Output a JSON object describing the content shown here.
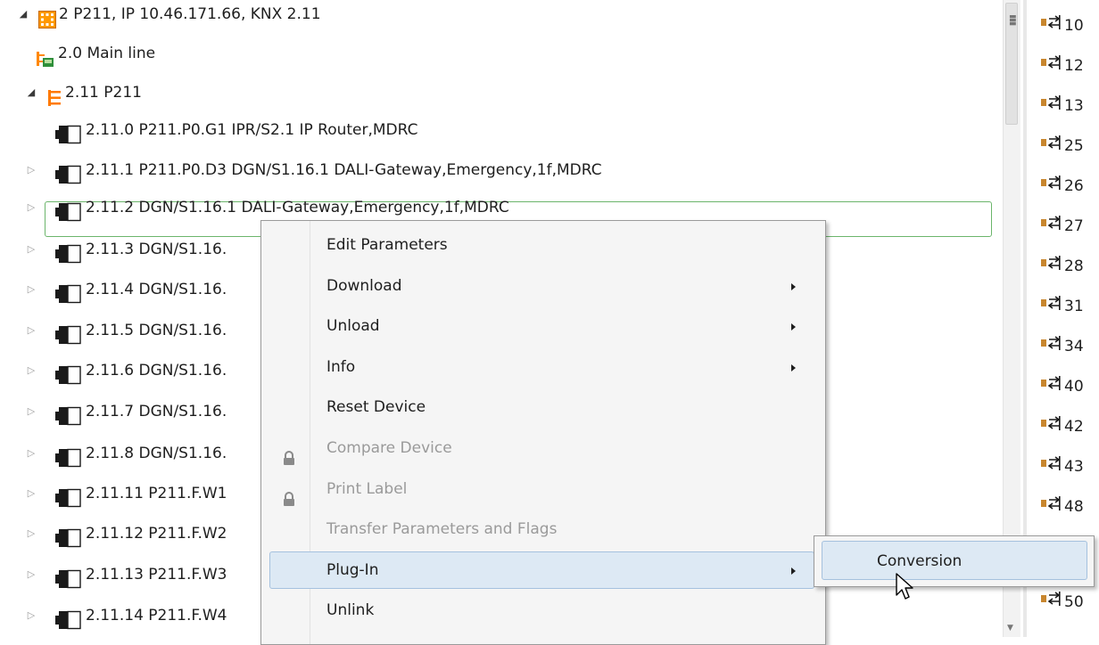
{
  "tree": {
    "rows": [
      {
        "label": "2 P211, IP 10.46.171.66, KNX 2.11",
        "icon": "area-icon",
        "expander": "open"
      },
      {
        "label": "2.0 Main line",
        "icon": "main-line-icon",
        "expander": "none"
      },
      {
        "label": "2.11 P211",
        "icon": "line-icon",
        "expander": "open"
      },
      {
        "label": "2.11.0 P211.P0.G1 IPR/S2.1 IP Router,MDRC",
        "icon": "device-icon",
        "expander": "none"
      },
      {
        "label": "2.11.1 P211.P0.D3 DGN/S1.16.1 DALI-Gateway,Emergency,1f,MDRC",
        "icon": "device-icon",
        "expander": "closed"
      },
      {
        "label": "2.11.2  DGN/S1.16.1 DALI-Gateway,Emergency,1f,MDRC",
        "icon": "device-icon",
        "expander": "closed"
      },
      {
        "label": "2.11.3  DGN/S1.16.",
        "icon": "device-icon",
        "expander": "closed"
      },
      {
        "label": "2.11.4  DGN/S1.16.",
        "icon": "device-icon",
        "expander": "closed"
      },
      {
        "label": "2.11.5  DGN/S1.16.",
        "icon": "device-icon",
        "expander": "closed"
      },
      {
        "label": "2.11.6  DGN/S1.16.",
        "icon": "device-icon",
        "expander": "closed"
      },
      {
        "label": "2.11.7  DGN/S1.16.",
        "icon": "device-icon",
        "expander": "closed"
      },
      {
        "label": "2.11.8  DGN/S1.16.",
        "icon": "device-icon",
        "expander": "closed"
      },
      {
        "label": "2.11.11 P211.F.W1",
        "icon": "device-icon",
        "expander": "closed"
      },
      {
        "label": "2.11.12 P211.F.W2",
        "icon": "device-icon",
        "expander": "closed"
      },
      {
        "label": "2.11.13 P211.F.W3",
        "icon": "device-icon",
        "expander": "closed"
      },
      {
        "label": "2.11.14 P211.F.W4",
        "icon": "device-icon",
        "expander": "closed"
      }
    ]
  },
  "right_panel": {
    "items": [
      "10",
      "12",
      "13",
      "25",
      "26",
      "27",
      "28",
      "31",
      "34",
      "40",
      "42",
      "43",
      "48",
      "50",
      "",
      "50"
    ]
  },
  "context_menu": {
    "items": [
      {
        "label": "Edit Parameters",
        "submenu": false,
        "disabled": false,
        "lock": false
      },
      {
        "label": "Download",
        "submenu": true,
        "disabled": false,
        "lock": false
      },
      {
        "label": "Unload",
        "submenu": true,
        "disabled": false,
        "lock": false
      },
      {
        "label": "Info",
        "submenu": true,
        "disabled": false,
        "lock": false
      },
      {
        "label": "Reset Device",
        "submenu": false,
        "disabled": false,
        "lock": false
      },
      {
        "label": "Compare Device",
        "submenu": false,
        "disabled": true,
        "lock": true
      },
      {
        "label": "Print Label",
        "submenu": false,
        "disabled": true,
        "lock": true
      },
      {
        "label": "Transfer Parameters and Flags",
        "submenu": false,
        "disabled": true,
        "lock": false
      },
      {
        "label": "Plug-In",
        "submenu": true,
        "disabled": false,
        "lock": false,
        "hover": true
      },
      {
        "label": "Unlink",
        "submenu": false,
        "disabled": false,
        "lock": false
      }
    ]
  },
  "plugin_submenu": {
    "item": "Conversion"
  },
  "colors": {
    "selection_border": "#6bb56b",
    "menu_highlight": "#dde9f4",
    "device_icon": "#1a1a1a",
    "item_icon_orange": "#c8862e"
  }
}
